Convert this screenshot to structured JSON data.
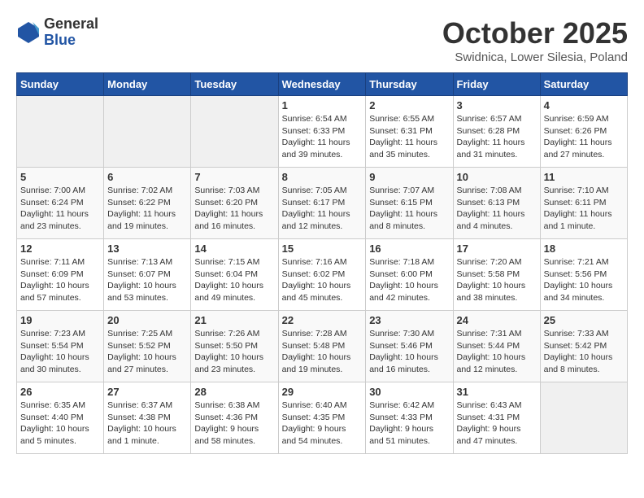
{
  "logo": {
    "general": "General",
    "blue": "Blue"
  },
  "header": {
    "month": "October 2025",
    "location": "Swidnica, Lower Silesia, Poland"
  },
  "weekdays": [
    "Sunday",
    "Monday",
    "Tuesday",
    "Wednesday",
    "Thursday",
    "Friday",
    "Saturday"
  ],
  "weeks": [
    [
      {
        "day": "",
        "info": ""
      },
      {
        "day": "",
        "info": ""
      },
      {
        "day": "",
        "info": ""
      },
      {
        "day": "1",
        "info": "Sunrise: 6:54 AM\nSunset: 6:33 PM\nDaylight: 11 hours\nand 39 minutes."
      },
      {
        "day": "2",
        "info": "Sunrise: 6:55 AM\nSunset: 6:31 PM\nDaylight: 11 hours\nand 35 minutes."
      },
      {
        "day": "3",
        "info": "Sunrise: 6:57 AM\nSunset: 6:28 PM\nDaylight: 11 hours\nand 31 minutes."
      },
      {
        "day": "4",
        "info": "Sunrise: 6:59 AM\nSunset: 6:26 PM\nDaylight: 11 hours\nand 27 minutes."
      }
    ],
    [
      {
        "day": "5",
        "info": "Sunrise: 7:00 AM\nSunset: 6:24 PM\nDaylight: 11 hours\nand 23 minutes."
      },
      {
        "day": "6",
        "info": "Sunrise: 7:02 AM\nSunset: 6:22 PM\nDaylight: 11 hours\nand 19 minutes."
      },
      {
        "day": "7",
        "info": "Sunrise: 7:03 AM\nSunset: 6:20 PM\nDaylight: 11 hours\nand 16 minutes."
      },
      {
        "day": "8",
        "info": "Sunrise: 7:05 AM\nSunset: 6:17 PM\nDaylight: 11 hours\nand 12 minutes."
      },
      {
        "day": "9",
        "info": "Sunrise: 7:07 AM\nSunset: 6:15 PM\nDaylight: 11 hours\nand 8 minutes."
      },
      {
        "day": "10",
        "info": "Sunrise: 7:08 AM\nSunset: 6:13 PM\nDaylight: 11 hours\nand 4 minutes."
      },
      {
        "day": "11",
        "info": "Sunrise: 7:10 AM\nSunset: 6:11 PM\nDaylight: 11 hours\nand 1 minute."
      }
    ],
    [
      {
        "day": "12",
        "info": "Sunrise: 7:11 AM\nSunset: 6:09 PM\nDaylight: 10 hours\nand 57 minutes."
      },
      {
        "day": "13",
        "info": "Sunrise: 7:13 AM\nSunset: 6:07 PM\nDaylight: 10 hours\nand 53 minutes."
      },
      {
        "day": "14",
        "info": "Sunrise: 7:15 AM\nSunset: 6:04 PM\nDaylight: 10 hours\nand 49 minutes."
      },
      {
        "day": "15",
        "info": "Sunrise: 7:16 AM\nSunset: 6:02 PM\nDaylight: 10 hours\nand 45 minutes."
      },
      {
        "day": "16",
        "info": "Sunrise: 7:18 AM\nSunset: 6:00 PM\nDaylight: 10 hours\nand 42 minutes."
      },
      {
        "day": "17",
        "info": "Sunrise: 7:20 AM\nSunset: 5:58 PM\nDaylight: 10 hours\nand 38 minutes."
      },
      {
        "day": "18",
        "info": "Sunrise: 7:21 AM\nSunset: 5:56 PM\nDaylight: 10 hours\nand 34 minutes."
      }
    ],
    [
      {
        "day": "19",
        "info": "Sunrise: 7:23 AM\nSunset: 5:54 PM\nDaylight: 10 hours\nand 30 minutes."
      },
      {
        "day": "20",
        "info": "Sunrise: 7:25 AM\nSunset: 5:52 PM\nDaylight: 10 hours\nand 27 minutes."
      },
      {
        "day": "21",
        "info": "Sunrise: 7:26 AM\nSunset: 5:50 PM\nDaylight: 10 hours\nand 23 minutes."
      },
      {
        "day": "22",
        "info": "Sunrise: 7:28 AM\nSunset: 5:48 PM\nDaylight: 10 hours\nand 19 minutes."
      },
      {
        "day": "23",
        "info": "Sunrise: 7:30 AM\nSunset: 5:46 PM\nDaylight: 10 hours\nand 16 minutes."
      },
      {
        "day": "24",
        "info": "Sunrise: 7:31 AM\nSunset: 5:44 PM\nDaylight: 10 hours\nand 12 minutes."
      },
      {
        "day": "25",
        "info": "Sunrise: 7:33 AM\nSunset: 5:42 PM\nDaylight: 10 hours\nand 8 minutes."
      }
    ],
    [
      {
        "day": "26",
        "info": "Sunrise: 6:35 AM\nSunset: 4:40 PM\nDaylight: 10 hours\nand 5 minutes."
      },
      {
        "day": "27",
        "info": "Sunrise: 6:37 AM\nSunset: 4:38 PM\nDaylight: 10 hours\nand 1 minute."
      },
      {
        "day": "28",
        "info": "Sunrise: 6:38 AM\nSunset: 4:36 PM\nDaylight: 9 hours\nand 58 minutes."
      },
      {
        "day": "29",
        "info": "Sunrise: 6:40 AM\nSunset: 4:35 PM\nDaylight: 9 hours\nand 54 minutes."
      },
      {
        "day": "30",
        "info": "Sunrise: 6:42 AM\nSunset: 4:33 PM\nDaylight: 9 hours\nand 51 minutes."
      },
      {
        "day": "31",
        "info": "Sunrise: 6:43 AM\nSunset: 4:31 PM\nDaylight: 9 hours\nand 47 minutes."
      },
      {
        "day": "",
        "info": ""
      }
    ]
  ]
}
